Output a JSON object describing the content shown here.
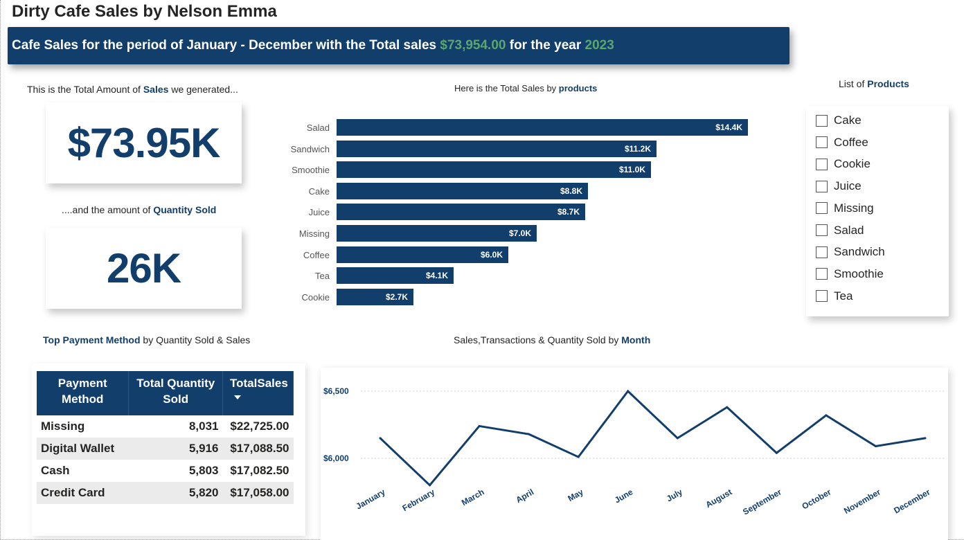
{
  "header": {
    "title": "Dirty Cafe Sales by Nelson Emma",
    "banner_prefix": "Cafe Sales for the period of January - December with the Total sales ",
    "banner_total": "$73,954.00",
    "banner_middle": " for the year ",
    "banner_year": "2023"
  },
  "kpis": {
    "sales_caption_pre": "This is the Total Amount of ",
    "sales_caption_bold": "Sales",
    "sales_caption_post": " we generated...",
    "sales_value": "$73.95K",
    "qty_caption_pre": "....and the amount of ",
    "qty_caption_bold": "Quantity Sold",
    "qty_value": "26K"
  },
  "product_chart": {
    "caption_pre": "Here is the Total Sales by ",
    "caption_bold": "products"
  },
  "slicer": {
    "caption_pre": "List of ",
    "caption_bold": "Products",
    "items": [
      "Cake",
      "Coffee",
      "Cookie",
      "Juice",
      "Missing",
      "Salad",
      "Sandwich",
      "Smoothie",
      "Tea"
    ]
  },
  "payment": {
    "caption_bold": "Top Payment Method",
    "caption_post": " by Quantity Sold & Sales",
    "headers": [
      "Payment Method",
      "Total Quantity Sold",
      "TotalSales"
    ],
    "rows": [
      [
        "Missing",
        "8,031",
        "$22,725.00"
      ],
      [
        "Digital Wallet",
        "5,916",
        "$17,088.50"
      ],
      [
        "Cash",
        "5,803",
        "$17,082.50"
      ],
      [
        "Credit Card",
        "5,820",
        "$17,058.00"
      ]
    ]
  },
  "monthly": {
    "caption_pre": "Sales,Transactions & Quantity Sold by ",
    "caption_bold": "Month"
  },
  "colors": {
    "navy": "#123e6c",
    "green": "#5ba56f"
  },
  "chart_data": [
    {
      "type": "bar",
      "orientation": "horizontal",
      "categories": [
        "Salad",
        "Sandwich",
        "Smoothie",
        "Cake",
        "Juice",
        "Missing",
        "Coffee",
        "Tea",
        "Cookie"
      ],
      "values": [
        14400,
        11200,
        11000,
        8800,
        8700,
        7000,
        6000,
        4100,
        2700
      ],
      "data_labels": [
        "$14.4K",
        "$11.2K",
        "$11.0K",
        "$8.8K",
        "$8.7K",
        "$7.0K",
        "$6.0K",
        "$4.1K",
        "$2.7K"
      ],
      "title": "Here is the Total Sales by products"
    },
    {
      "type": "line",
      "categories": [
        "January",
        "February",
        "March",
        "April",
        "May",
        "June",
        "July",
        "August",
        "September",
        "October",
        "November",
        "December"
      ],
      "values": [
        6150,
        5800,
        6240,
        6180,
        6010,
        6500,
        6150,
        6380,
        6040,
        6320,
        6090,
        6150
      ],
      "yticks": [
        "$6,000",
        "$6,500"
      ],
      "ylim": [
        5700,
        6600
      ],
      "grid": true,
      "title": "Sales,Transactions & Quantity Sold by Month"
    }
  ]
}
